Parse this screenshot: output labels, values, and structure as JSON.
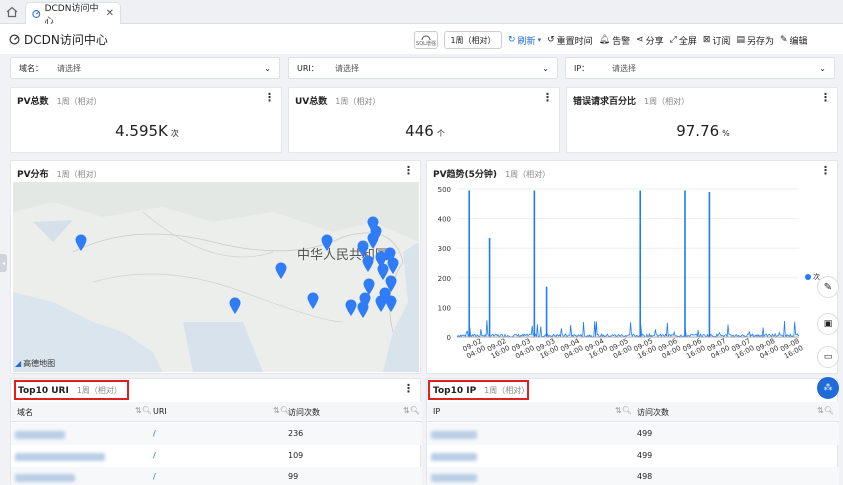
{
  "tab": {
    "label": "DCDN访问中心"
  },
  "header": {
    "title": "DCDN访问中心"
  },
  "toolbar": {
    "sql_badge": "SQL增强",
    "range": "1周（相对）",
    "refresh": "刷新",
    "reset": "重置时间",
    "alert": "告警",
    "share": "分享",
    "fullscreen": "全屏",
    "subscribe": "订阅",
    "save_as": "另存为",
    "edit": "编辑"
  },
  "filters": [
    {
      "label": "域名：",
      "placeholder": "请选择"
    },
    {
      "label": "URI：",
      "placeholder": "请选择"
    },
    {
      "label": "IP：",
      "placeholder": "请选择"
    }
  ],
  "stats": [
    {
      "title": "PV总数",
      "sub": "1周（相对）",
      "value": "4.595K",
      "unit": "次"
    },
    {
      "title": "UV总数",
      "sub": "1周（相对）",
      "value": "446",
      "unit": "个"
    },
    {
      "title": "错误请求百分比",
      "sub": "1周（相对）",
      "value": "97.76",
      "unit": "%"
    }
  ],
  "map": {
    "title": "PV分布",
    "sub": "1周（相对）",
    "country_label": "中华人民共和国",
    "logo": "高德地图"
  },
  "trend": {
    "title": "PV趋势(5分钟)",
    "sub": "1周（相对）",
    "legend": "次"
  },
  "chart_data": {
    "type": "line",
    "title": "PV趋势(5分钟)",
    "yticks": [
      0,
      100,
      200,
      300,
      400,
      500
    ],
    "ylim": [
      0,
      500
    ],
    "xticks": [
      "09-02 04:00",
      "09-02 16:00",
      "09-03 04:00",
      "09-03 16:00",
      "09-04 04:00",
      "09-04 16:00",
      "09-05 04:00",
      "09-05 16:00",
      "09-06 04:00",
      "09-06 16:00",
      "09-07 04:00",
      "09-07 16:00",
      "09-08 04:00",
      "09-08 16:00"
    ],
    "spikes": [
      {
        "x": "09-02 02:00",
        "y": 495
      },
      {
        "x": "09-02 12:00",
        "y": 335
      },
      {
        "x": "09-03 10:00",
        "y": 495
      },
      {
        "x": "09-03 16:00",
        "y": 170
      },
      {
        "x": "09-05 14:00",
        "y": 495
      },
      {
        "x": "09-06 12:00",
        "y": 495
      },
      {
        "x": "09-07 00:00",
        "y": 490
      }
    ],
    "baseline_noise": [
      10,
      60
    ],
    "legend": "top-right"
  },
  "top_uri": {
    "title": "Top10 URI",
    "sub": "1周（相对）",
    "headers": [
      "域名",
      "URI",
      "访问次数"
    ],
    "rows": [
      {
        "uri": "/",
        "count": "236"
      },
      {
        "uri": "/",
        "count": "109"
      },
      {
        "uri": "/",
        "count": "99"
      }
    ]
  },
  "top_ip": {
    "title": "Top10 IP",
    "sub": "1周（相对）",
    "headers": [
      "IP",
      "访问次数"
    ],
    "rows": [
      {
        "count": "499"
      },
      {
        "count": "499"
      },
      {
        "count": "498"
      }
    ]
  },
  "icons": [
    "home-icon",
    "dashboard-icon",
    "close-icon",
    "refresh-icon",
    "reset-time-icon",
    "bell-icon",
    "share-icon",
    "fullscreen-icon",
    "subscribe-icon",
    "save-icon",
    "edit-icon",
    "chevron-down-icon",
    "map-pin-icon",
    "search-icon",
    "sort-icon",
    "pen-icon",
    "book-icon",
    "chat-icon",
    "apps-icon"
  ],
  "colors": {
    "accent": "#1f6bd8",
    "pin": "#2f7cf6",
    "line": "#1f7bf5",
    "highlight": "#e02020"
  }
}
